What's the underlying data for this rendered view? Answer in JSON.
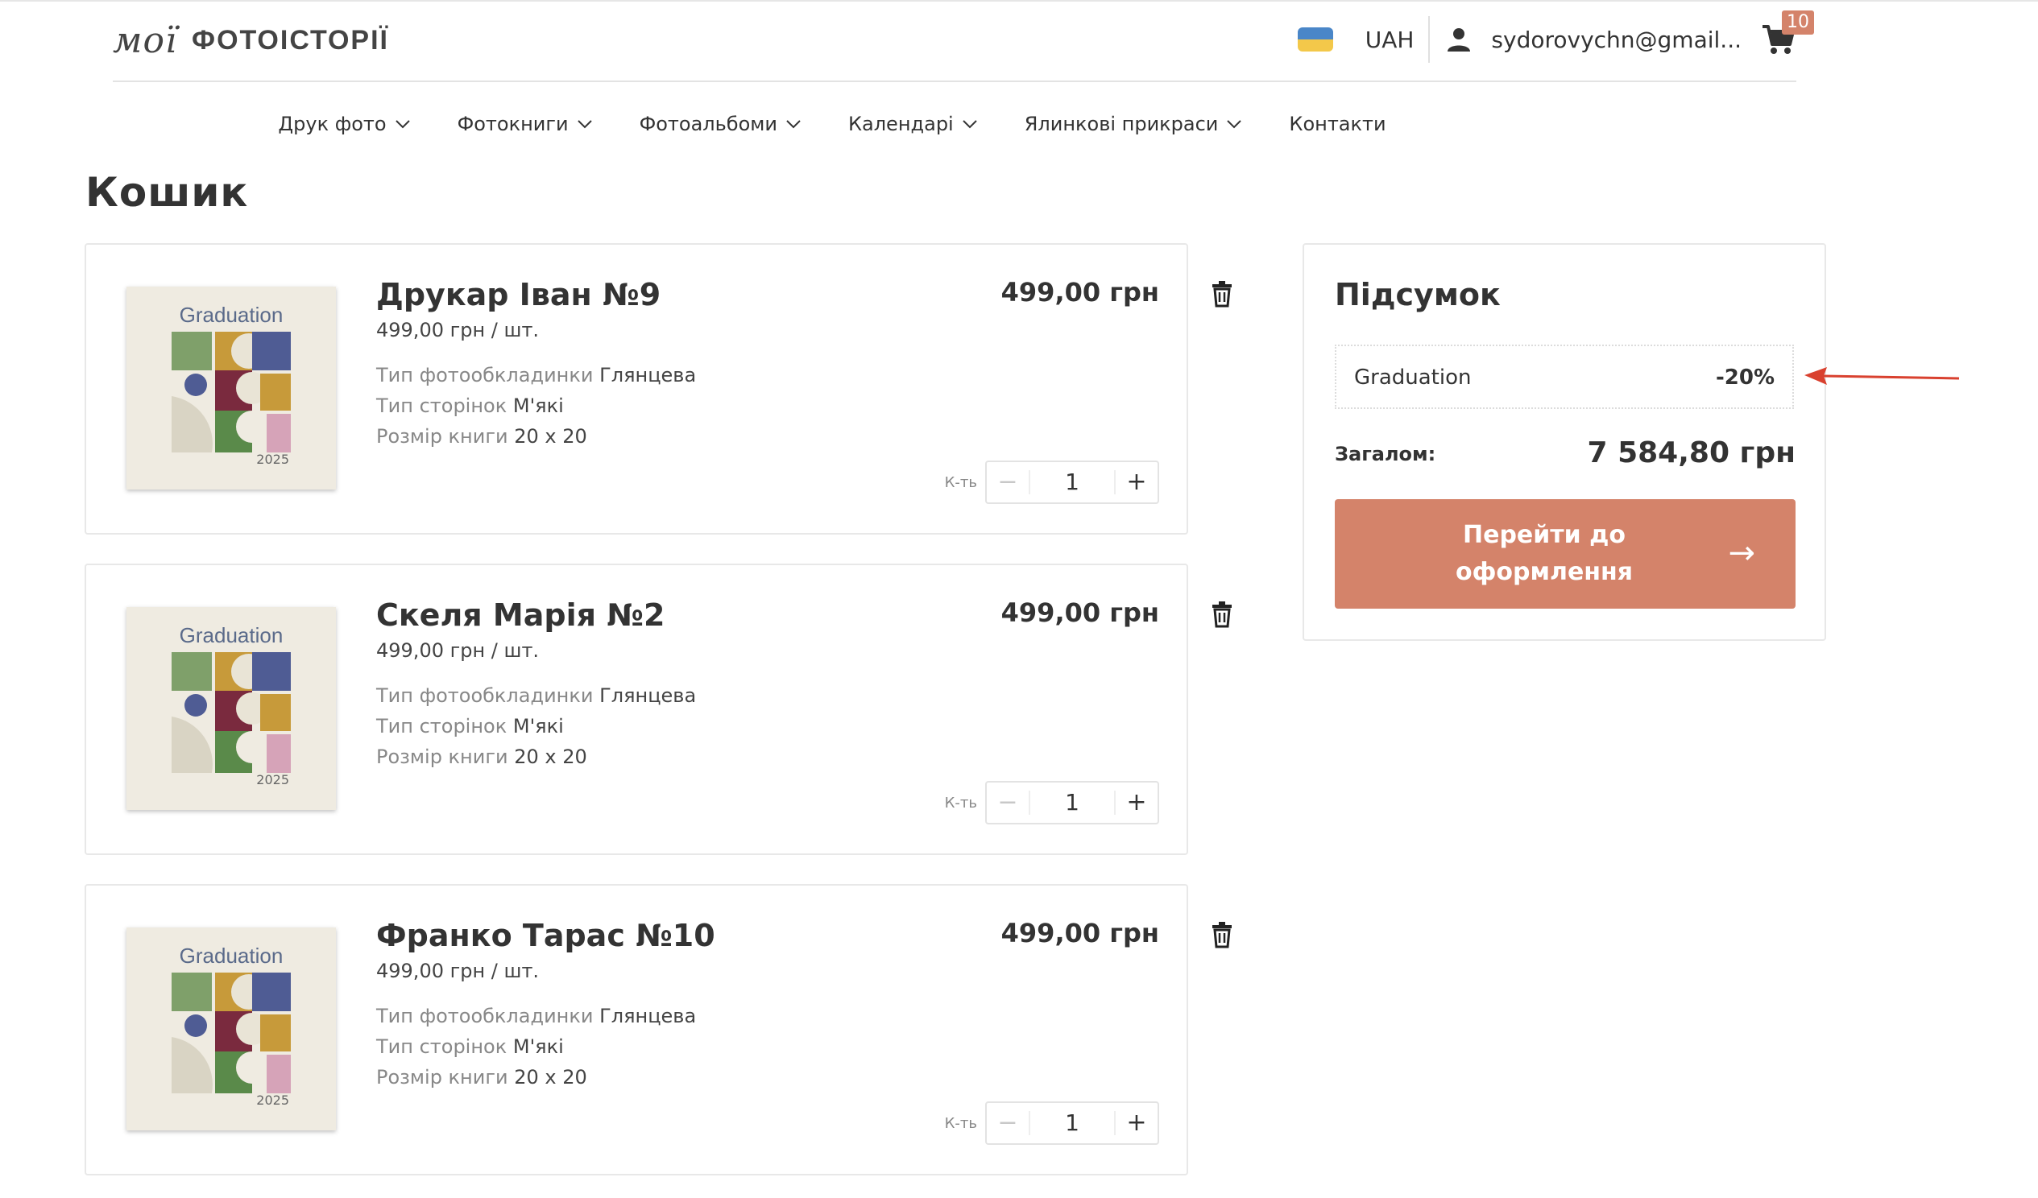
{
  "header": {
    "logo_script": "мої",
    "logo_text": "ФОТОІСТОРІЇ",
    "currency": "UAH",
    "email": "sydorovychn@gmail...",
    "cart_count": "10",
    "icons": [
      "flag-ua-icon",
      "user-icon",
      "cart-icon"
    ]
  },
  "nav": {
    "items": [
      {
        "label": "Друк фото"
      },
      {
        "label": "Фотокниги"
      },
      {
        "label": "Фотоальбоми"
      },
      {
        "label": "Календарі"
      },
      {
        "label": "Ялинкові прикраси"
      },
      {
        "label": "Контакти"
      }
    ]
  },
  "page": {
    "title": "Кошик"
  },
  "cart": {
    "option_labels": {
      "cover": "Тип фотообкладинки",
      "pages": "Тип сторінок",
      "size": "Розмір книги"
    },
    "qty_label": "К-ть",
    "thumb": {
      "title": "Graduation",
      "year": "2025"
    },
    "items": [
      {
        "name": "Друкар Іван №9",
        "unit_price": "499,00 грн / шт.",
        "cover": "Глянцева",
        "pages": "М'які",
        "size": "20 х 20",
        "price": "499,00 грн",
        "qty": "1"
      },
      {
        "name": "Скеля Марія №2",
        "unit_price": "499,00 грн / шт.",
        "cover": "Глянцева",
        "pages": "М'які",
        "size": "20 х 20",
        "price": "499,00 грн",
        "qty": "1"
      },
      {
        "name": "Франко Тарас №10",
        "unit_price": "499,00 грн / шт.",
        "cover": "Глянцева",
        "pages": "М'які",
        "size": "20 х 20",
        "price": "499,00 грн",
        "qty": "1"
      }
    ]
  },
  "summary": {
    "title": "Підсумок",
    "promo_name": "Graduation",
    "promo_discount": "-20%",
    "total_label": "Загалом:",
    "total_value": "7 584,80 грн",
    "checkout_label_line1": "Перейти до",
    "checkout_label_line2": "оформлення",
    "checkout_arrow": "→"
  },
  "colors": {
    "accent": "#d4836a",
    "arrow_annotation": "#d9412f",
    "text": "#333333",
    "muted": "#888888"
  }
}
